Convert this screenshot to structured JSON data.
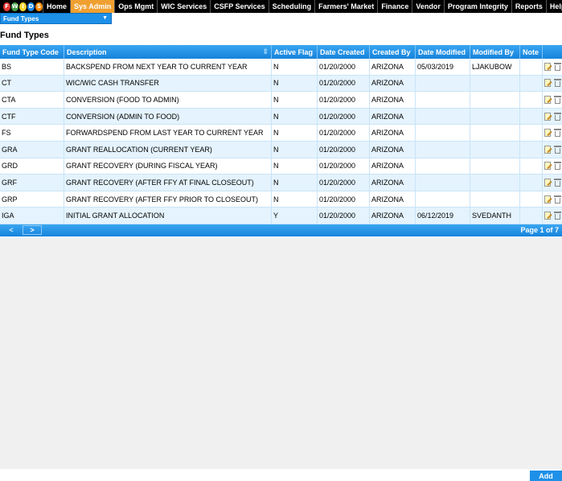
{
  "nav": {
    "logo_letters": [
      "F",
      "W",
      "I",
      "D",
      "S"
    ],
    "logo_colors": [
      "#e53935",
      "#43a047",
      "#fdd835",
      "#1e88e5",
      "#fb8c00"
    ],
    "items": [
      "Home",
      "Sys Admin",
      "Ops Mgmt",
      "WIC Services",
      "CSFP Services",
      "Scheduling",
      "Farmers' Market",
      "Finance",
      "Vendor",
      "Program Integrity",
      "Reports",
      "Help"
    ],
    "active": "Sys Admin"
  },
  "selector": {
    "value": "Fund Types"
  },
  "page": {
    "title": "Fund Types"
  },
  "table": {
    "columns": [
      "Fund Type Code",
      "Description",
      "Active Flag",
      "Date Created",
      "Created By",
      "Date Modified",
      "Modified By",
      "Note"
    ],
    "rows": [
      [
        "BS",
        "BACKSPEND FROM NEXT YEAR TO CURRENT YEAR",
        "N",
        "01/20/2000",
        "ARIZONA",
        "05/03/2019",
        "LJAKUBOW",
        ""
      ],
      [
        "CT",
        "WIC/WIC CASH TRANSFER",
        "N",
        "01/20/2000",
        "ARIZONA",
        "",
        "",
        ""
      ],
      [
        "CTA",
        "CONVERSION (FOOD TO ADMIN)",
        "N",
        "01/20/2000",
        "ARIZONA",
        "",
        "",
        ""
      ],
      [
        "CTF",
        "CONVERSION (ADMIN TO FOOD)",
        "N",
        "01/20/2000",
        "ARIZONA",
        "",
        "",
        ""
      ],
      [
        "FS",
        "FORWARDSPEND FROM LAST YEAR TO CURRENT YEAR",
        "N",
        "01/20/2000",
        "ARIZONA",
        "",
        "",
        ""
      ],
      [
        "GRA",
        "GRANT REALLOCATION (CURRENT YEAR)",
        "N",
        "01/20/2000",
        "ARIZONA",
        "",
        "",
        ""
      ],
      [
        "GRD",
        "GRANT RECOVERY (DURING FISCAL YEAR)",
        "N",
        "01/20/2000",
        "ARIZONA",
        "",
        "",
        ""
      ],
      [
        "GRF",
        "GRANT RECOVERY (AFTER FFY AT FINAL CLOSEOUT)",
        "N",
        "01/20/2000",
        "ARIZONA",
        "",
        "",
        ""
      ],
      [
        "GRP",
        "GRANT RECOVERY (AFTER FFY PRIOR TO CLOSEOUT)",
        "N",
        "01/20/2000",
        "ARIZONA",
        "",
        "",
        ""
      ],
      [
        "IGA",
        "INITIAL GRANT ALLOCATION",
        "Y",
        "01/20/2000",
        "ARIZONA",
        "06/12/2019",
        "SVEDANTH",
        ""
      ]
    ]
  },
  "pager": {
    "prev": "<",
    "next": ">",
    "label": "Page 1 of 7"
  },
  "actions": {
    "add": "Add"
  }
}
